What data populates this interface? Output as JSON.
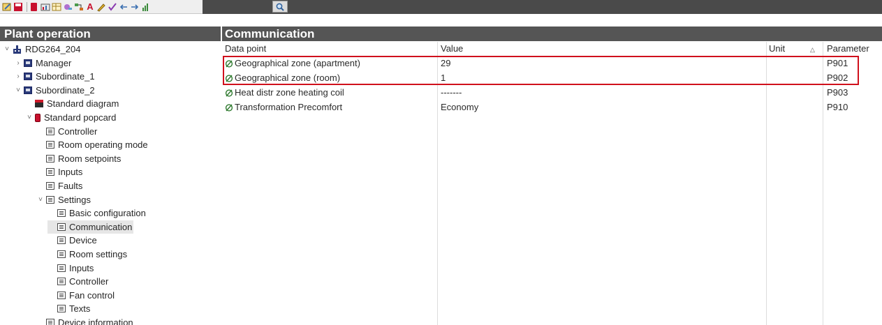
{
  "toolbar": {
    "buttons": [
      "edit-icon",
      "save-icon",
      "record-icon",
      "chart-icon",
      "table-icon",
      "tools-icon",
      "flow-icon",
      "text-tool-icon",
      "pencil-icon",
      "check-icon",
      "back-arrow-icon",
      "forward-arrow-icon",
      "bars-icon"
    ],
    "search_icon": "magnifier-icon"
  },
  "left_pane": {
    "title": "Plant operation",
    "tree": [
      {
        "label": "RDG264_204",
        "icon": "plant-icon",
        "twisty": "expanded"
      },
      {
        "label": "Manager",
        "icon": "device-icon",
        "twisty": "collapsed"
      },
      {
        "label": "Subordinate_1",
        "icon": "device-icon",
        "twisty": "collapsed"
      },
      {
        "label": "Subordinate_2",
        "icon": "device-icon",
        "twisty": "expanded"
      },
      {
        "label": "Standard diagram",
        "icon": "diagram-icon",
        "twisty": ""
      },
      {
        "label": "Standard popcard",
        "icon": "popcard-icon",
        "twisty": "expanded"
      },
      {
        "label": "Controller",
        "icon": "page-icon",
        "twisty": ""
      },
      {
        "label": "Room operating mode",
        "icon": "page-icon",
        "twisty": ""
      },
      {
        "label": "Room setpoints",
        "icon": "page-icon",
        "twisty": ""
      },
      {
        "label": "Inputs",
        "icon": "page-icon",
        "twisty": ""
      },
      {
        "label": "Faults",
        "icon": "page-icon",
        "twisty": ""
      },
      {
        "label": "Settings",
        "icon": "page-icon",
        "twisty": "expanded"
      },
      {
        "label": "Basic configuration",
        "icon": "page-icon",
        "twisty": ""
      },
      {
        "label": "Communication",
        "icon": "page-icon",
        "twisty": ""
      },
      {
        "label": "Device",
        "icon": "page-icon",
        "twisty": ""
      },
      {
        "label": "Room settings",
        "icon": "page-icon",
        "twisty": ""
      },
      {
        "label": "Inputs",
        "icon": "page-icon",
        "twisty": ""
      },
      {
        "label": "Controller",
        "icon": "page-icon",
        "twisty": ""
      },
      {
        "label": "Fan control",
        "icon": "page-icon",
        "twisty": ""
      },
      {
        "label": "Texts",
        "icon": "page-icon",
        "twisty": ""
      },
      {
        "label": "Device information",
        "icon": "page-icon",
        "twisty": ""
      }
    ]
  },
  "right_pane": {
    "title": "Communication",
    "columns": {
      "data_point": "Data point",
      "value": "Value",
      "unit": "Unit",
      "parameter": "Parameter"
    },
    "rows": [
      {
        "data_point": "Geographical zone (apartment)",
        "value": "29",
        "unit": "",
        "parameter": "P901"
      },
      {
        "data_point": "Geographical zone (room)",
        "value": "1",
        "unit": "",
        "parameter": "P902"
      },
      {
        "data_point": "Heat distr zone heating coil",
        "value": "-------",
        "unit": "",
        "parameter": "P903"
      },
      {
        "data_point": "Transformation Precomfort",
        "value": "Economy",
        "unit": "",
        "parameter": "P910"
      }
    ]
  },
  "colors": {
    "header_bg": "#555555",
    "highlight_border": "#d0101c"
  }
}
